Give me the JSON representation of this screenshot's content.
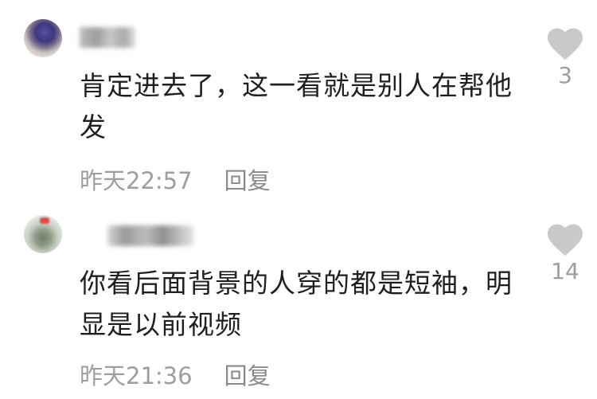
{
  "comments": [
    {
      "text": "肯定进去了，这一看就是别人在帮他发",
      "time": "昨天22:57",
      "reply_label": "回复",
      "likes": "3"
    },
    {
      "text": "你看后面背景的人穿的都是短袖，明显是以前视频",
      "time": "昨天21:36",
      "reply_label": "回复",
      "likes": "14"
    }
  ],
  "icons": {
    "like": "heart-icon"
  },
  "colors": {
    "text": "#1f1f1f",
    "meta": "#9e9e9e",
    "heart": "#c9c9c9"
  }
}
